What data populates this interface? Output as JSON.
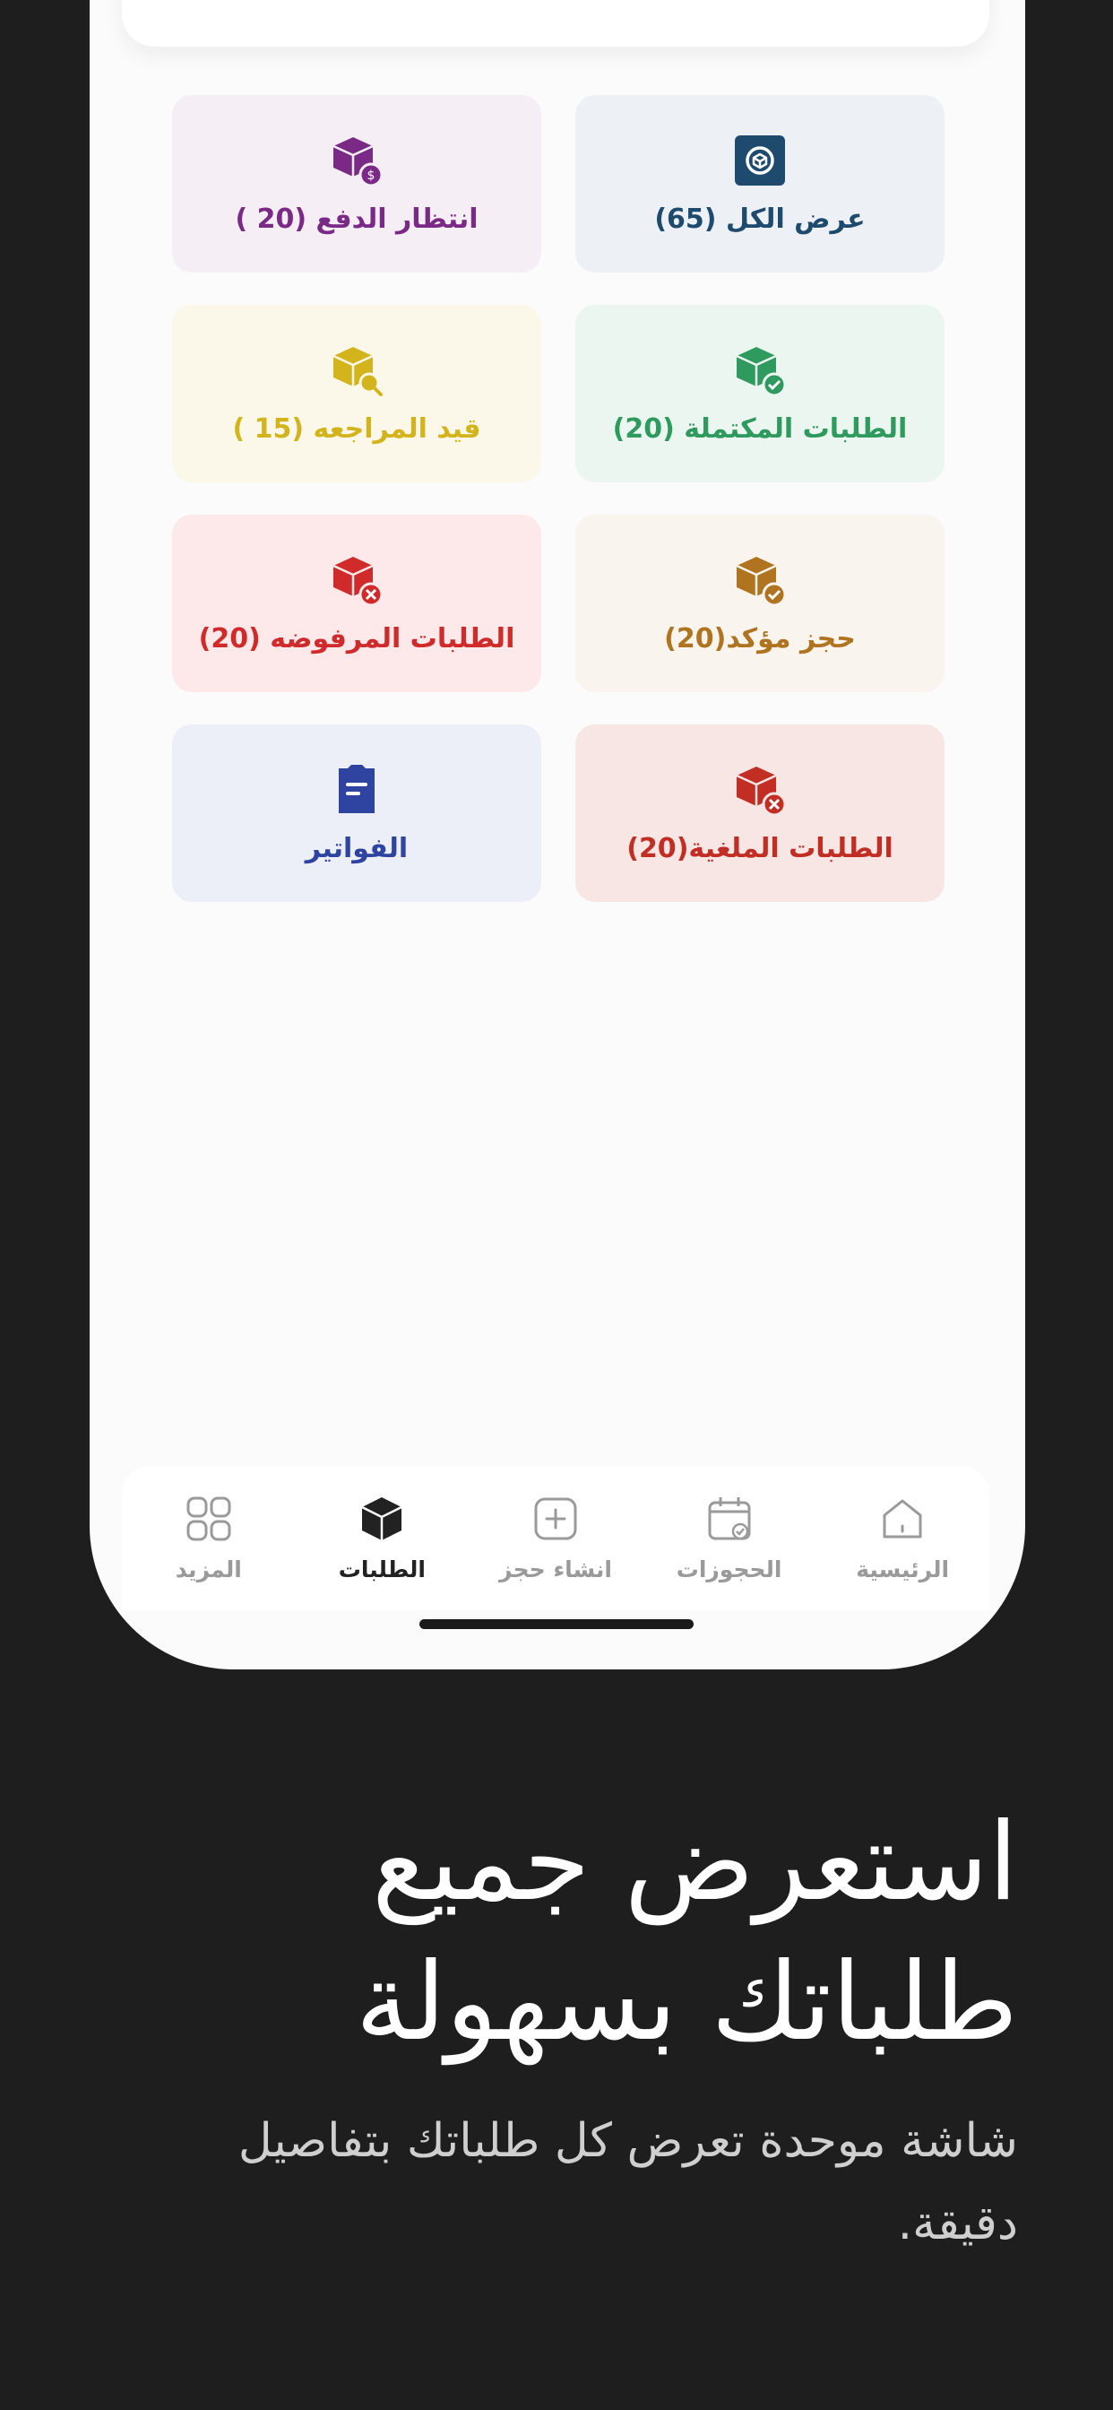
{
  "tiles": [
    {
      "label": "عرض الكل (65)",
      "icon": "view-all-icon",
      "bg": "#edf0f4",
      "color": "#1e4a6e"
    },
    {
      "label": "انتظار الدفع (20 )",
      "icon": "pending-payment-icon",
      "bg": "#f5eff5",
      "color": "#7a2a86"
    },
    {
      "label": "الطلبات المكتملة (20)",
      "icon": "completed-orders-icon",
      "bg": "#ecf6f0",
      "color": "#2e9a5e"
    },
    {
      "label": "قيد المراجعه (15 )",
      "icon": "under-review-icon",
      "bg": "#fbf8ea",
      "color": "#d3b41c"
    },
    {
      "label": "حجز مؤكد(20)",
      "icon": "confirmed-booking-icon",
      "bg": "#f9f4ee",
      "color": "#b0731f"
    },
    {
      "label": "الطلبات المرفوضه (20)",
      "icon": "rejected-orders-icon",
      "bg": "#fde9e9",
      "color": "#d02a2a"
    },
    {
      "label": "الطلبات الملغية(20)",
      "icon": "cancelled-orders-icon",
      "bg": "#f7e6e4",
      "color": "#c22d24"
    },
    {
      "label": "الفواتير",
      "icon": "invoices-icon",
      "bg": "#eceff8",
      "color": "#2f43a1"
    }
  ],
  "nav": {
    "home": "الرئيسية",
    "bookings": "الحجوزات",
    "create": "انشاء حجز",
    "orders": "الطلبات",
    "more": "المزيد"
  },
  "headline": {
    "line1": "استعرض جميع",
    "line2": "طلباتك بسهولة"
  },
  "subtitle": {
    "line1": "شاشة موحدة تعرض كل طلباتك بتفاصيل",
    "line2": "دقيقة."
  }
}
